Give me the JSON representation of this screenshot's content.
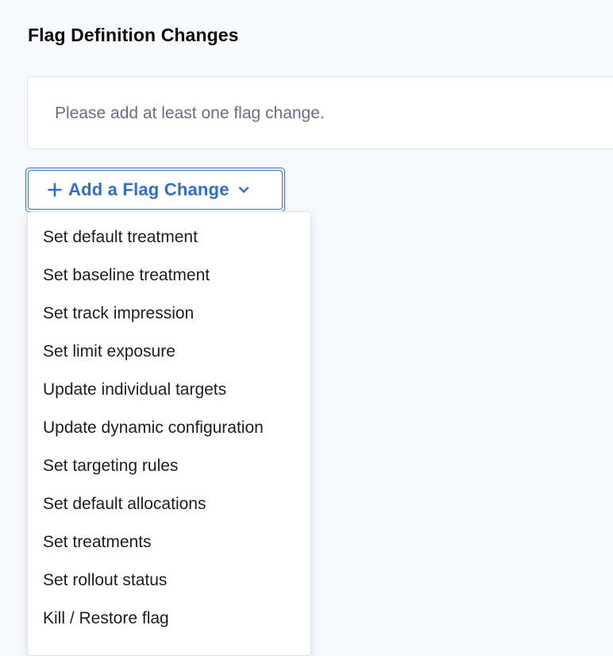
{
  "section": {
    "title": "Flag Definition Changes"
  },
  "empty_state": {
    "message": "Please add at least one flag change."
  },
  "add_button": {
    "label": "Add a Flag Change",
    "icon_left": "plus-icon",
    "icon_right": "chevron-down-icon",
    "color": "#2f6ec9"
  },
  "dropdown": {
    "items": [
      "Set default treatment",
      "Set baseline treatment",
      "Set track impression",
      "Set limit exposure",
      "Update individual targets",
      "Update dynamic configuration",
      "Set targeting rules",
      "Set default allocations",
      "Set treatments",
      "Set rollout status",
      "Kill / Restore flag"
    ]
  }
}
